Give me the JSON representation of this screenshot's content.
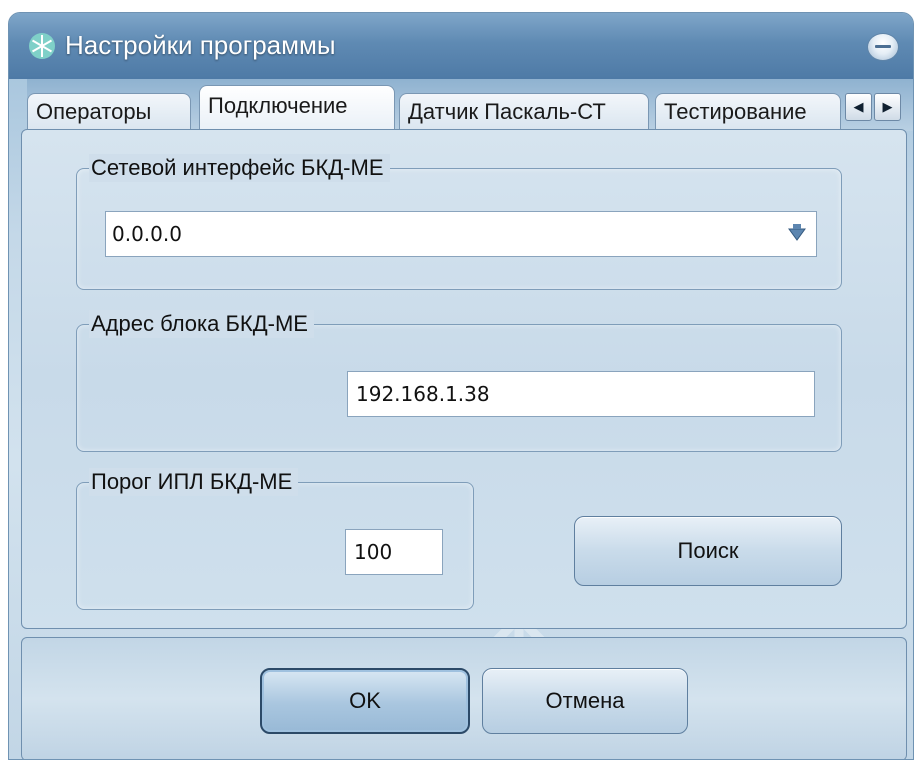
{
  "window": {
    "title": "Настройки программы"
  },
  "tabs": [
    {
      "label": "Операторы"
    },
    {
      "label": "Подключение"
    },
    {
      "label": "Датчик Паскаль-СТ"
    },
    {
      "label": "Тестирование"
    }
  ],
  "network_group": {
    "label": "Сетевой интерфейс БКД-МЕ",
    "selected_value": "0.0.0.0"
  },
  "address_group": {
    "label": "Адрес блока БКД-МЕ",
    "value": "192.168.1.38"
  },
  "threshold_group": {
    "label": "Порог ИПЛ БКД-МЕ",
    "value": "100"
  },
  "search_button": {
    "label": "Поиск"
  },
  "footer": {
    "ok_label": "OK",
    "cancel_label": "Отмена"
  },
  "icons": {
    "app": "snowflake-icon",
    "close": "close-icon",
    "combo": "dropdown-arrow-icon",
    "tab_left": "chevron-left-icon",
    "tab_right": "chevron-right-icon"
  },
  "colors": {
    "titlebar": "#5f8ab3",
    "panel": "#cfdeeb",
    "accent": "#2c4a68"
  }
}
